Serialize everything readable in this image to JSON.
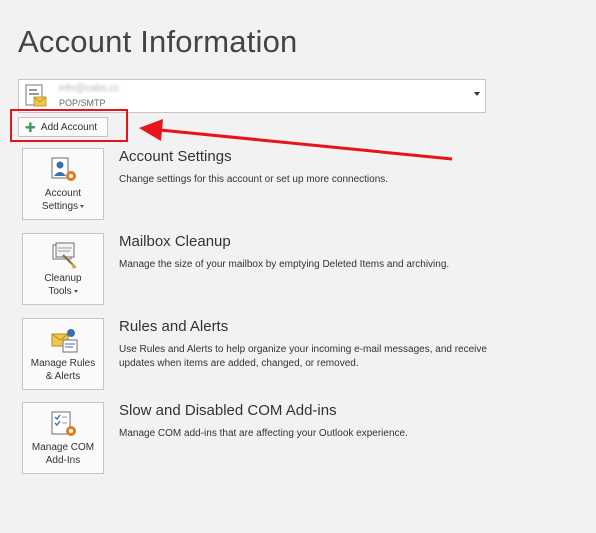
{
  "page": {
    "title": "Account Information"
  },
  "account_selector": {
    "email": "info@cabs.cc",
    "type": "POP/SMTP",
    "icon": "mail-account-icon"
  },
  "add_account": {
    "label": "Add Account",
    "icon": "plus-icon",
    "highlight_color": "#e8141a"
  },
  "sections": [
    {
      "tile_line1": "Account",
      "tile_line2": "Settings",
      "has_dropdown": true,
      "icon": "account-settings-icon",
      "title": "Account Settings",
      "description": "Change settings for this account or set up more connections."
    },
    {
      "tile_line1": "Cleanup",
      "tile_line2": "Tools",
      "has_dropdown": true,
      "icon": "cleanup-tools-icon",
      "title": "Mailbox Cleanup",
      "description": "Manage the size of your mailbox by emptying Deleted Items and archiving."
    },
    {
      "tile_line1": "Manage Rules",
      "tile_line2": "& Alerts",
      "has_dropdown": false,
      "icon": "rules-alerts-icon",
      "title": "Rules and Alerts",
      "description": "Use Rules and Alerts to help organize your incoming e-mail messages, and receive updates when items are added, changed, or removed."
    },
    {
      "tile_line1": "Manage COM",
      "tile_line2": "Add-Ins",
      "has_dropdown": false,
      "icon": "com-addins-icon",
      "title": "Slow and Disabled COM Add-ins",
      "description": "Manage COM add-ins that are affecting your Outlook experience."
    }
  ]
}
